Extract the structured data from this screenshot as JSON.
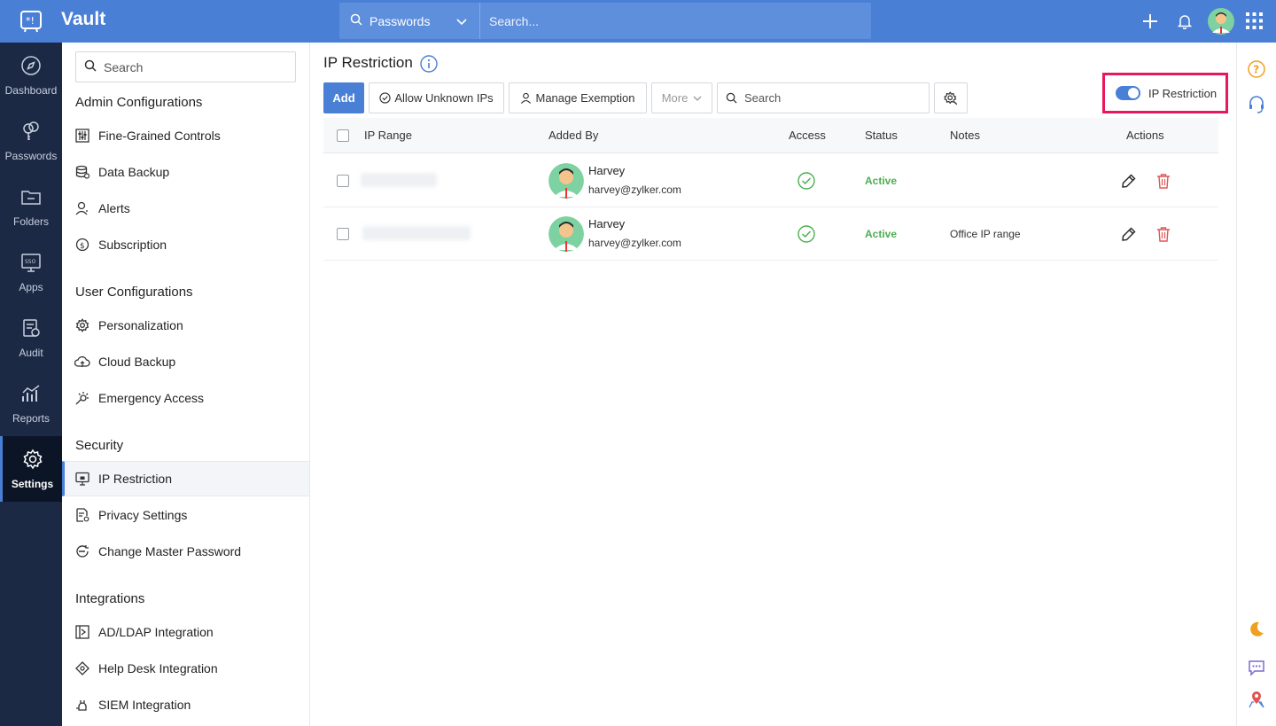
{
  "app": {
    "title": "Vault"
  },
  "topbar": {
    "search_scope": "Passwords",
    "search_placeholder": "Search..."
  },
  "leftnav": {
    "items": [
      {
        "label": "Dashboard",
        "icon": "compass-icon"
      },
      {
        "label": "Passwords",
        "icon": "keys-icon"
      },
      {
        "label": "Folders",
        "icon": "folder-icon"
      },
      {
        "label": "Apps",
        "icon": "sso-icon"
      },
      {
        "label": "Audit",
        "icon": "clipboard-icon"
      },
      {
        "label": "Reports",
        "icon": "chart-icon"
      },
      {
        "label": "Settings",
        "icon": "gear-icon",
        "active": true
      }
    ]
  },
  "sidebar": {
    "search_placeholder": "Search",
    "sections": [
      {
        "title": "Admin Configurations",
        "items": [
          "Fine-Grained Controls",
          "Data Backup",
          "Alerts",
          "Subscription"
        ]
      },
      {
        "title": "User Configurations",
        "items": [
          "Personalization",
          "Cloud Backup",
          "Emergency Access"
        ]
      },
      {
        "title": "Security",
        "items": [
          "IP Restriction",
          "Privacy Settings",
          "Change Master Password"
        ]
      },
      {
        "title": "Integrations",
        "items": [
          "AD/LDAP Integration",
          "Help Desk Integration",
          "SIEM Integration"
        ]
      }
    ],
    "active_item": "IP Restriction"
  },
  "main": {
    "title": "IP Restriction",
    "toolbar": {
      "add": "Add",
      "allow_unknown": "Allow Unknown IPs",
      "manage_exemption": "Manage Exemption",
      "more": "More",
      "search_placeholder": "Search"
    },
    "toggle": {
      "label": "IP Restriction",
      "on": true
    },
    "table": {
      "headers": [
        "IP Range",
        "Added By",
        "Access",
        "Status",
        "Notes",
        "Actions"
      ],
      "rows": [
        {
          "name": "Harvey",
          "email": "harvey@zylker.com",
          "status": "Active",
          "notes": ""
        },
        {
          "name": "Harvey",
          "email": "harvey@zylker.com",
          "status": "Active",
          "notes": "Office IP range"
        }
      ]
    }
  },
  "colors": {
    "brand": "#4a7fd6",
    "nav_bg": "#1b2944",
    "active_status": "#4caf50",
    "highlight": "#e8185a",
    "delete": "#e05454"
  }
}
